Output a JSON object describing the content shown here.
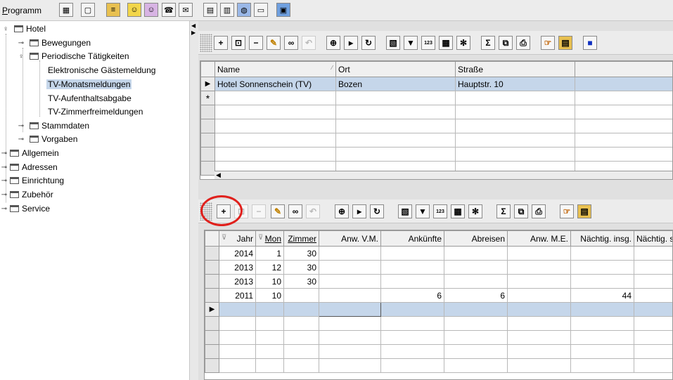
{
  "menu": {
    "programm_first": "P",
    "programm_rest": "rogramm"
  },
  "tree": {
    "hotel": "Hotel",
    "bewegungen": "Bewegungen",
    "periodische": "Periodische Tätigkeiten",
    "gaeste": "Elektronische Gästemeldung",
    "monats": "TV-Monatsmeldungen",
    "aufenthalt": "TV-Aufenthaltsabgabe",
    "zimmerfrei": "TV-Zimmerfreimeldungen",
    "stammdaten": "Stammdaten",
    "vorgaben": "Vorgaben",
    "allgemein": "Allgemein",
    "adressen": "Adressen",
    "einrichtung": "Einrichtung",
    "zubehoer": "Zubehör",
    "service": "Service"
  },
  "top_grid": {
    "headers": [
      "Name",
      "Ort",
      "Straße",
      ""
    ],
    "row": [
      "Hotel Sonnenschein (TV)",
      "Bozen",
      "Hauptstr. 10",
      ""
    ],
    "new_row_marker": "*"
  },
  "bottom_grid": {
    "headers": [
      "Jahr",
      "Mon",
      "Zimmer",
      "Anw. V.M.",
      "Ankünfte",
      "Abreisen",
      "Anw. M.E.",
      "Nächtig. insg.",
      "Nächtig. s"
    ],
    "rows": [
      [
        "2014",
        "1",
        "30",
        "",
        "",
        "",
        "",
        "",
        ""
      ],
      [
        "2013",
        "12",
        "30",
        "",
        "",
        "",
        "",
        "",
        ""
      ],
      [
        "2013",
        "10",
        "30",
        "",
        "",
        "",
        "",
        "",
        ""
      ],
      [
        "2011",
        "10",
        "",
        "",
        "6",
        "6",
        "",
        "44",
        ""
      ]
    ]
  },
  "icons": {
    "plus": "+",
    "minus": "−",
    "sigma": "Σ",
    "sort_indicator": "⁄",
    "row_pointer": "▶"
  }
}
